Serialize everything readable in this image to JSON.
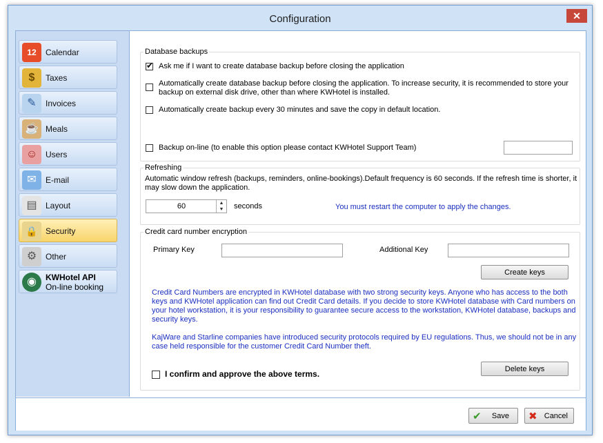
{
  "window": {
    "title": "Configuration",
    "close_glyph": "✕"
  },
  "sidebar": {
    "items": [
      {
        "label": "Calendar",
        "icon": "calendar-icon",
        "glyph": "12"
      },
      {
        "label": "Taxes",
        "icon": "coins-icon",
        "glyph": "$"
      },
      {
        "label": "Invoices",
        "icon": "invoice-icon",
        "glyph": "✎"
      },
      {
        "label": "Meals",
        "icon": "meals-icon",
        "glyph": "☕"
      },
      {
        "label": "Users",
        "icon": "users-icon",
        "glyph": "☺"
      },
      {
        "label": "E-mail",
        "icon": "email-icon",
        "glyph": "✉"
      },
      {
        "label": "Layout",
        "icon": "layout-icon",
        "glyph": "▤"
      },
      {
        "label": "Security",
        "icon": "lock-icon",
        "glyph": "🔒",
        "active": true
      },
      {
        "label": "Other",
        "icon": "gears-icon",
        "glyph": "⚙"
      },
      {
        "label": "KWHotel API",
        "label2": "On-line booking",
        "icon": "api-icon",
        "glyph": "◉"
      }
    ]
  },
  "backups": {
    "legend": "Database backups",
    "opt1": {
      "label": "Ask me if I want to create database backup before closing the application",
      "checked": true
    },
    "opt2": {
      "label_line1": "Automatically create database backup before closing the application. To increase security, it is recommended to store your",
      "label_line2": "backup on external disk drive, other than where KWHotel is installed.",
      "checked": false
    },
    "opt3": {
      "label": "Automatically create backup every 30 minutes and save the copy in default location.",
      "checked": false
    },
    "opt4": {
      "label": "Backup on-line (to enable this option please contact KWHotel Support Team)",
      "checked": false,
      "value": ""
    }
  },
  "refreshing": {
    "legend": "Refreshing",
    "desc_line1": "Automatic window refresh (backups, reminders, online-bookings).Default frequency is 60 seconds. If the refresh time is shorter, it",
    "desc_line2": "may slow down the application.",
    "value": "60",
    "unit": "seconds",
    "notice": "You must restart the computer to apply the changes."
  },
  "encryption": {
    "legend": "Credit card number encryption",
    "primary_label": "Primary Key",
    "primary_value": "",
    "additional_label": "Additional Key",
    "additional_value": "",
    "create_button": "Create keys",
    "info1_l1": "Credit Card Numbers are encrypted in KWHotel database with two strong security keys. Anyone who has access to the both",
    "info1_l2": "keys and KWHotel application can find out Credit Card details. If you decide to store KWHotel database with Card numbers on",
    "info1_l3": "your hotel workstation, it is your responsibility to guarantee secure access to the workstation, KWHotel database, backups and",
    "info1_l4": "security keys.",
    "info2_l1": "KajWare and Starline companies have introduced security protocols required by EU regulations. Thus, we should not be in any",
    "info2_l2": "case held responsible for the customer Credit Card Number theft.",
    "confirm_label": "I confirm and approve the above terms.",
    "confirm_checked": false,
    "delete_button": "Delete keys"
  },
  "footer": {
    "save_label": "Save",
    "cancel_label": "Cancel",
    "save_glyph": "✔",
    "cancel_glyph": "✖"
  },
  "colors": {
    "accent": "#1a2ec0",
    "active_nav": "#f8d46b",
    "frame": "#cfe2f6"
  }
}
